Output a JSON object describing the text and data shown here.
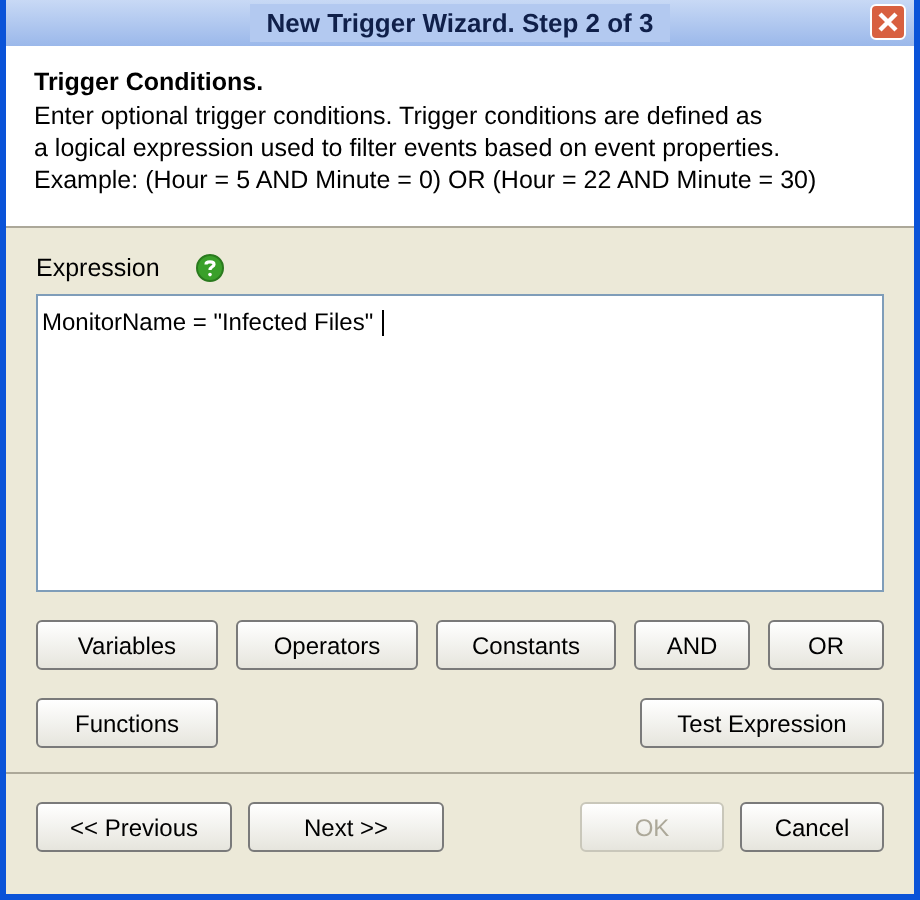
{
  "window": {
    "title": "New Trigger Wizard. Step 2 of 3"
  },
  "header": {
    "heading": "Trigger Conditions.",
    "lines": [
      "Enter optional trigger conditions. Trigger conditions are defined as",
      "a logical expression used to filter events based on event properties.",
      "Example: (Hour = 5 AND Minute = 0) OR (Hour = 22 AND Minute = 30)"
    ]
  },
  "expression": {
    "label": "Expression",
    "value": "MonitorName = \"Infected Files\""
  },
  "builder_buttons": [
    {
      "label": "Variables"
    },
    {
      "label": "Operators"
    },
    {
      "label": "Constants"
    },
    {
      "label": "AND"
    },
    {
      "label": "OR"
    }
  ],
  "function_buttons": [
    {
      "label": "Functions"
    },
    {
      "label": "Test Expression"
    }
  ],
  "footer_buttons": [
    {
      "label": "<< Previous",
      "disabled": false
    },
    {
      "label": "Next >>",
      "disabled": false
    },
    {
      "label": "OK",
      "disabled": true
    },
    {
      "label": "Cancel",
      "disabled": false
    }
  ]
}
